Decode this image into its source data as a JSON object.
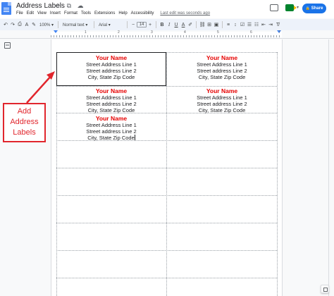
{
  "app": {
    "doc_title": "Address Labels",
    "title_icons": "☆ ⧉ ☁",
    "last_edit": "Last edit was seconds ago",
    "share_label": "Share",
    "share_icon": "🔒"
  },
  "menu": [
    "File",
    "Edit",
    "View",
    "Insert",
    "Format",
    "Tools",
    "Extensions",
    "Help",
    "Accessibility"
  ],
  "toolbar": {
    "undo": "↶",
    "redo": "↷",
    "print": "⎙",
    "spellcheck": "A",
    "paint_format": "✎",
    "zoom": "100%",
    "style": "Normal text",
    "font": "Arial",
    "font_size_minus": "−",
    "font_size": "14",
    "font_size_plus": "+",
    "bold": "B",
    "italic": "I",
    "underline": "U",
    "text_color": "A",
    "highlight": "✐",
    "link": "⛓",
    "comment": "⊞",
    "image": "▣",
    "align": "≡",
    "line_spacing": "↕",
    "checklist": "☑",
    "bullets": "☰",
    "numbered": "☷",
    "indent_less": "⇤",
    "indent_more": "⇥",
    "clear_format": "T̸"
  },
  "ruler": {
    "numbers": [
      "1",
      "2",
      "3",
      "4",
      "5",
      "6",
      "7"
    ]
  },
  "labels": [
    {
      "name": "Your Name",
      "line1": "Street Address Line 1",
      "line2": "Street address Line 2",
      "line3": "City, State Zip Code"
    },
    {
      "name": "Your Name",
      "line1": "Street Address Line 1",
      "line2": "Street address Line 2",
      "line3": "City, State Zip Code"
    },
    {
      "name": "Your Name",
      "line1": "Street Address Line 1",
      "line2": "Street address Line 2",
      "line3": "City, State Zip Code"
    },
    {
      "name": "Your Name",
      "line1": "Street Address Line 1",
      "line2": "Street address Line 2",
      "line3": "City, State Zip Code"
    },
    {
      "name": "Your Name",
      "line1": "Street Address Line 1",
      "line2": "Street address Line 2",
      "line3": "City, State Zip Code"
    }
  ],
  "callout": {
    "line1": "Add",
    "line2": "Address",
    "line3": "Labels"
  },
  "colors": {
    "label_name": "#e60000",
    "callout": "#e1262d",
    "share": "#1a73e8",
    "toolbar_bg": "#edf2fa"
  }
}
